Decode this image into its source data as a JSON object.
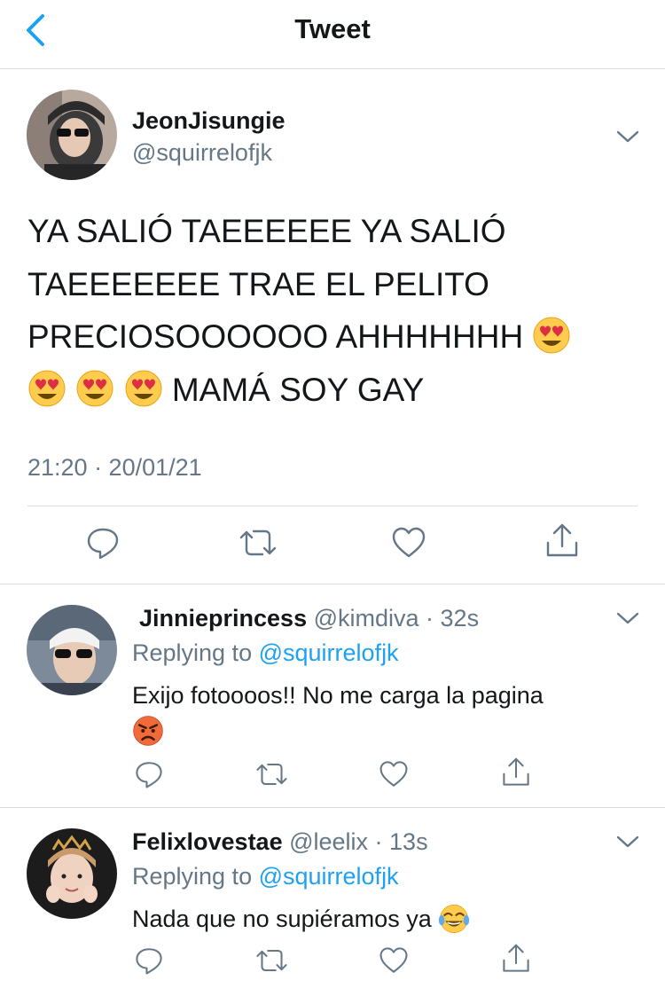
{
  "nav": {
    "title": "Tweet"
  },
  "main_tweet": {
    "display_name": "JeonJisungie",
    "handle": "@squirrelofjk",
    "text_part1": "YA SALIÓ TAEEEEEE YA SALIÓ TAEEEEEEE TRAE EL PELITO PRECIOSOOOOOO AHHHHHHH",
    "text_part2": "MAMÁ SOY GAY",
    "emoji_name": "heart-eyes",
    "timestamp": "21:20 · 20/01/21"
  },
  "replies": [
    {
      "display_name": "Jinnieprincess",
      "handle_time": "@kimdiva · 32s",
      "replying_prefix": "Replying to",
      "replying_mention": "@squirrelofjk",
      "text": "Exijo fotoooos!! No me carga la pagina",
      "emoji_name": "angry-face"
    },
    {
      "display_name": "Felixlovestae",
      "handle_time": "@leelix · 13s",
      "replying_prefix": "Replying to",
      "replying_mention": "@squirrelofjk",
      "text": "Nada que no supiéramos ya",
      "emoji_name": "tears-of-joy"
    }
  ],
  "colors": {
    "accent": "#1da1f2",
    "text": "#14171a",
    "secondary": "#657786",
    "divider": "#d9dde1"
  }
}
